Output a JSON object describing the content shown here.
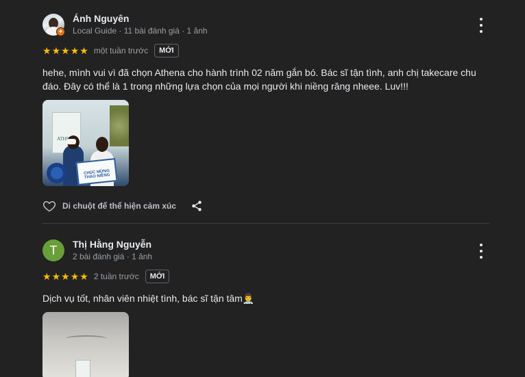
{
  "reviews": [
    {
      "name": "Ánh Nguyên",
      "meta": "Local Guide · 11 bài đánh giá · 1 ảnh",
      "guide_badge": "✦",
      "rating": 5,
      "date": "một tuần trước",
      "badge": "MỚI",
      "text": "hehe, mình vui vì đã chọn Athena cho hành trình 02 năm gắn bó. Bác sĩ tận tình, anh chị takecare chu đáo. Đây có thể là 1 trong những lựa chọn của mọi người khi niềng răng nheee. Luv!!!",
      "photo_sign": "ATHENA",
      "photo_board": "CHÚC MỪNG THÁO NIỀNG",
      "like_label": "Di chuột để thể hiện cảm xúc"
    },
    {
      "name": "Thị Hằng Nguyễn",
      "avatar_letter": "T",
      "avatar_color": "#689f38",
      "meta": "2 bài đánh giá · 1 ảnh",
      "rating": 5,
      "date": "2 tuần trước",
      "badge": "MỚI",
      "text": "Dịch vụ tốt, nhân viên nhiệt tình, bác sĩ tận tâm👨‍⚕️"
    }
  ],
  "colors": {
    "background": "#222222",
    "star": "#fbbc04",
    "text": "#e8eaed",
    "secondary_text": "#9aa0a6"
  },
  "icons": [
    "more-vert-icon",
    "star-icon",
    "heart-outline-icon",
    "share-icon",
    "local-guide-icon"
  ]
}
